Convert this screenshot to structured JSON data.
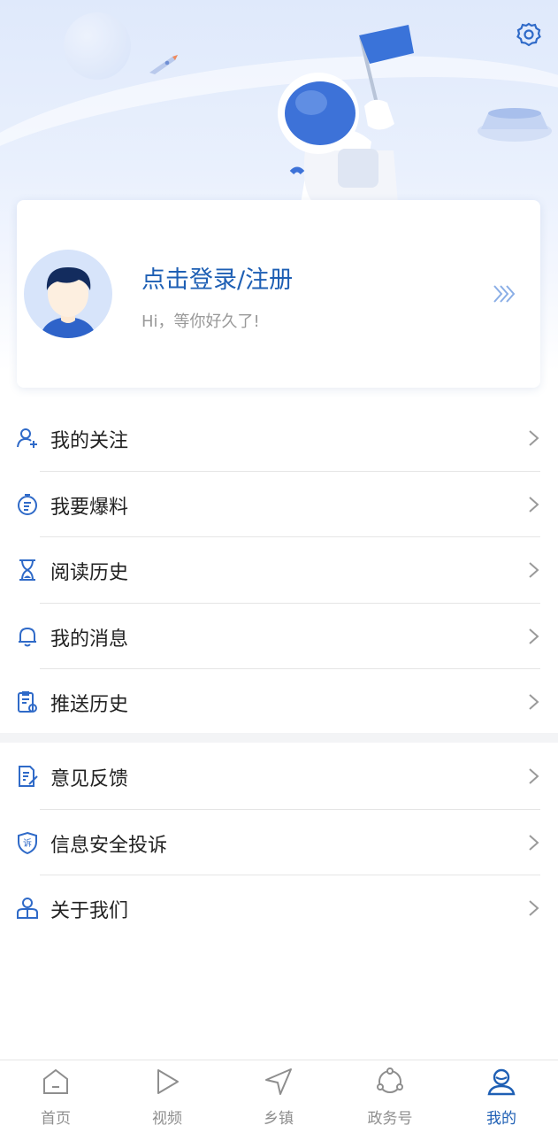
{
  "login": {
    "title": "点击登录/注册",
    "subtitle": "Hi，等你好久了!"
  },
  "menu_group_1": [
    {
      "label": "我的关注",
      "icon": "user-add-icon"
    },
    {
      "label": "我要爆料",
      "icon": "timer-report-icon"
    },
    {
      "label": "阅读历史",
      "icon": "hourglass-icon"
    },
    {
      "label": "我的消息",
      "icon": "bell-icon"
    },
    {
      "label": "推送历史",
      "icon": "clipboard-eye-icon"
    }
  ],
  "menu_group_2": [
    {
      "label": "意见反馈",
      "icon": "edit-document-icon"
    },
    {
      "label": "信息安全投诉",
      "icon": "shield-complaint-icon"
    },
    {
      "label": "关于我们",
      "icon": "person-badge-icon"
    }
  ],
  "tabs": [
    {
      "label": "首页",
      "icon": "home-icon",
      "active": false
    },
    {
      "label": "视频",
      "icon": "play-icon",
      "active": false
    },
    {
      "label": "乡镇",
      "icon": "navigation-icon",
      "active": false
    },
    {
      "label": "政务号",
      "icon": "share-circle-icon",
      "active": false
    },
    {
      "label": "我的",
      "icon": "profile-icon",
      "active": true
    }
  ],
  "colors": {
    "accent": "#1e5fb4",
    "icon_blue": "#2f6ac8",
    "inactive": "#8e8e8e"
  }
}
